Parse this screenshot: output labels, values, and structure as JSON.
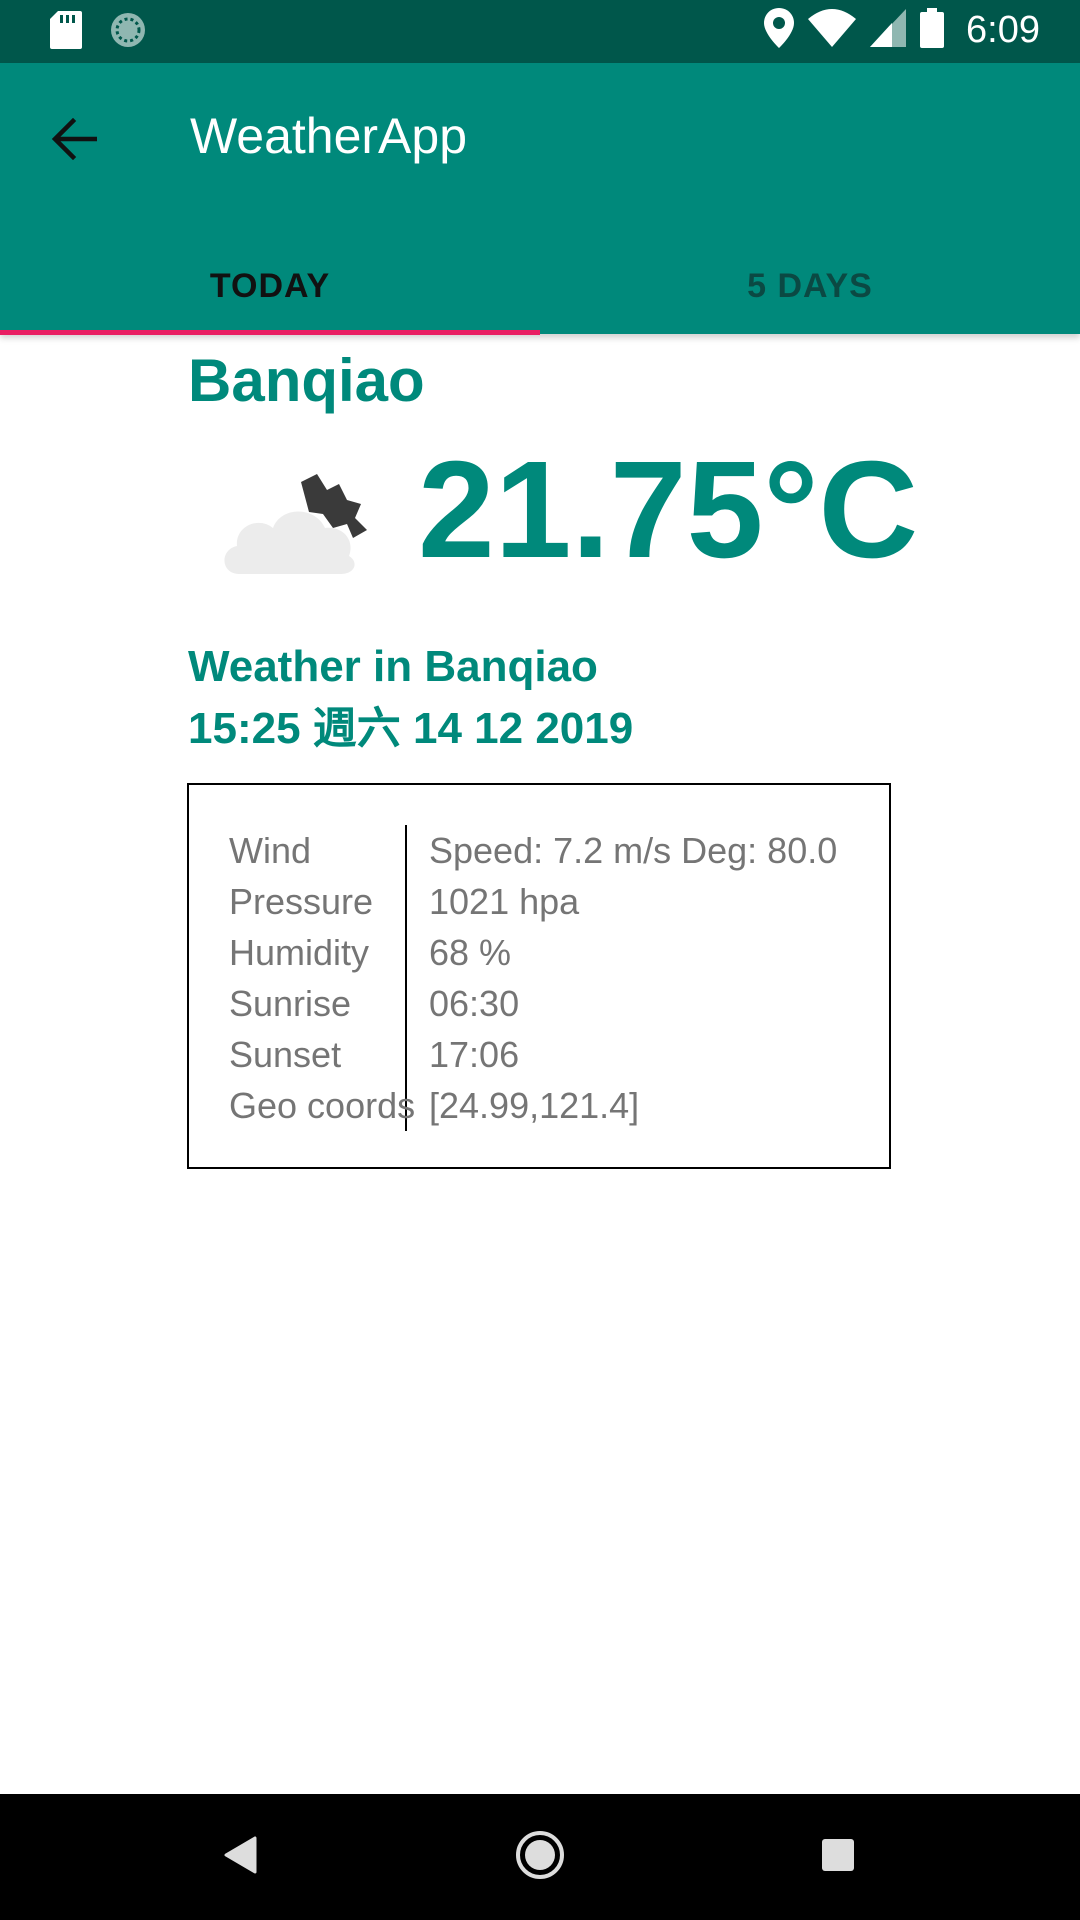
{
  "status_bar": {
    "time": "6:09",
    "icons": [
      "sd-card-icon",
      "sync-icon",
      "location-icon",
      "wifi-icon",
      "signal-icon",
      "battery-icon"
    ]
  },
  "app_bar": {
    "title": "WeatherApp",
    "back_icon": "arrow-back-icon",
    "tabs": [
      {
        "label": "TODAY",
        "active": true
      },
      {
        "label": "5 DAYS",
        "active": false
      }
    ]
  },
  "weather": {
    "city": "Banqiao",
    "icon": "cloud-night-icon",
    "temperature": "21.75°C",
    "subtitle_line1": "Weather in Banqiao",
    "subtitle_line2": "15:25 週六 14 12 2019"
  },
  "details": {
    "rows": [
      {
        "label": "Wind",
        "value": "Speed: 7.2 m/s Deg: 80.0"
      },
      {
        "label": "Pressure",
        "value": "1021 hpa"
      },
      {
        "label": "Humidity",
        "value": "68 %"
      },
      {
        "label": "Sunrise",
        "value": "06:30"
      },
      {
        "label": "Sunset",
        "value": "17:06"
      },
      {
        "label": "Geo coords",
        "value": "[24.99,121.4]"
      }
    ]
  },
  "nav_bar": {
    "icons": [
      "back-triangle-icon",
      "home-circle-icon",
      "recents-square-icon"
    ]
  },
  "colors": {
    "status_bar": "#00574b",
    "primary": "#00897b",
    "accent": "#e91e63",
    "detail_text": "#757575"
  }
}
